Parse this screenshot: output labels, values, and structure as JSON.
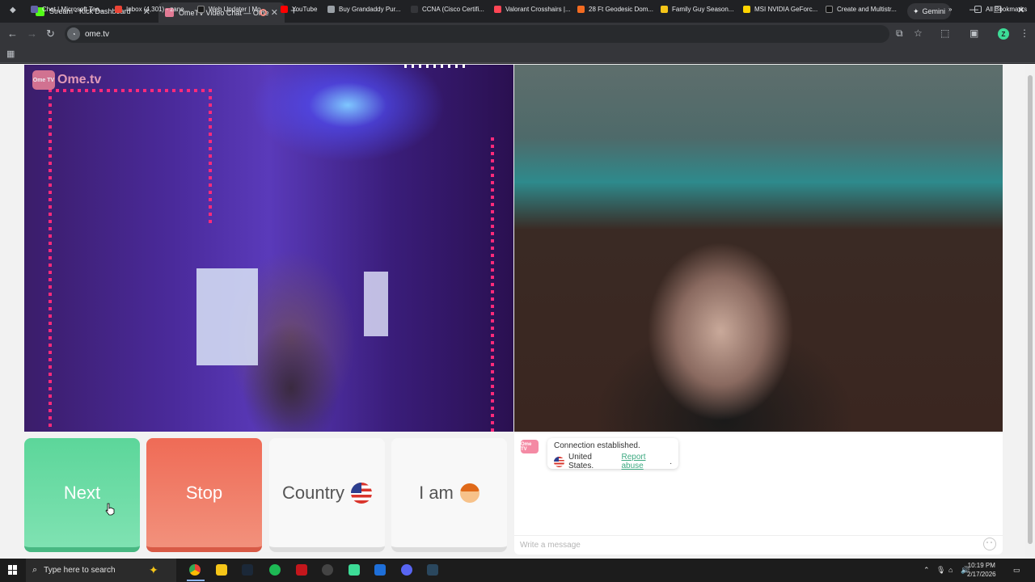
{
  "browser": {
    "tabs": [
      {
        "title": "Stream - Kick Dashboard",
        "favicon_color": "#53fc18",
        "active": false
      },
      {
        "title": "OmeTV Video Chat — Ome",
        "favicon_color": "#e27b95",
        "active": true
      }
    ],
    "new_tab_label": "+",
    "gemini_label": "Gemini",
    "url": "ome.tv",
    "bookmarks": [
      {
        "label": "Chat | Microsoft Tea...",
        "color": "#6264a7"
      },
      {
        "label": "Inbox (4,301) - zane...",
        "color": "#ea4335"
      },
      {
        "label": "Web Updater | Mo...",
        "color": "#1a1a1a"
      },
      {
        "label": "YouTube",
        "color": "#ff0000"
      },
      {
        "label": "Buy Grandaddy Pur...",
        "color": "#9aa0a6"
      },
      {
        "label": "CCNA (Cisco Certifi...",
        "color": "#35363a"
      },
      {
        "label": "Valorant Crosshairs |...",
        "color": "#ff4655"
      },
      {
        "label": "28 Ft Geodesic Dom...",
        "color": "#f36b21"
      },
      {
        "label": "Family Guy Season...",
        "color": "#f5c518"
      },
      {
        "label": "MSI NVIDIA GeForc...",
        "color": "#ffd400"
      },
      {
        "label": "Create and Multistr...",
        "color": "#111111"
      }
    ],
    "bookmarks_overflow": "»",
    "all_bookmarks_label": "All Bookmarks",
    "profile_initial": "Z"
  },
  "ometv": {
    "logo_badge": "Ome TV",
    "logo_text": "Ome.tv",
    "buttons": {
      "next": "Next",
      "stop": "Stop",
      "country": "Country",
      "iam": "I am"
    },
    "chat": {
      "bot_logo": "Ome TV",
      "status_message": "Connection established.",
      "country_name": "United States.",
      "report_link": "Report abuse",
      "report_suffix": ".",
      "input_placeholder": "Write a message"
    }
  },
  "taskbar": {
    "search_placeholder": "Type here to search",
    "time": "10:19 PM",
    "date": "2/17/2026"
  }
}
